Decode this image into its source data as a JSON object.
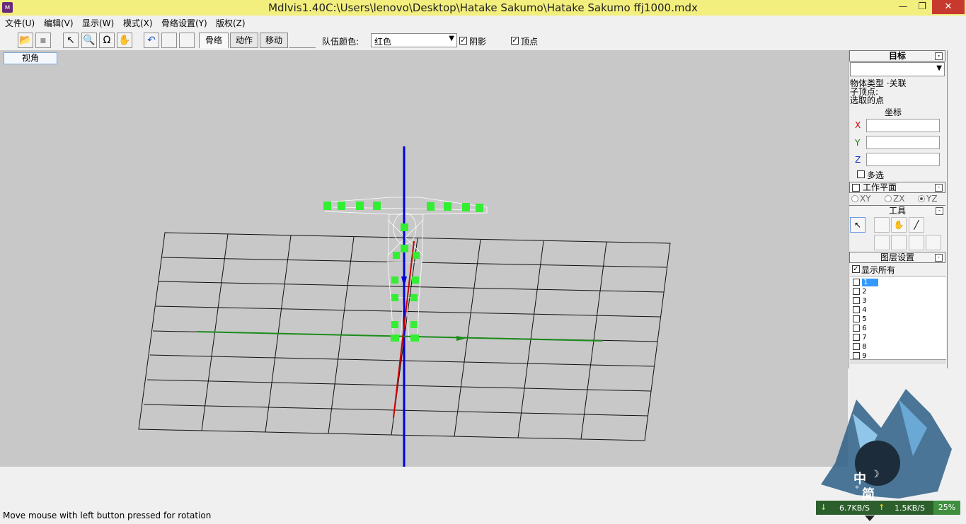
{
  "window": {
    "title": "Mdlvis1.40C:\\Users\\lenovo\\Desktop\\Hatake Sakumo\\Hatake Sakumo ffj1000.mdx",
    "minimize": "—",
    "restore": "❐",
    "close": "✕"
  },
  "menu": [
    "文件(U)",
    "编辑(V)",
    "显示(W)",
    "模式(X)",
    "骨络设置(Y)",
    "版权(Z)"
  ],
  "toolbar": {
    "tabs": [
      "骨络",
      "动作",
      "移动"
    ],
    "team_color_label": "队伍颜色:",
    "team_color_value": "红色",
    "shadow_label": "阴影",
    "vertex_label": "顶点"
  },
  "viewport": {
    "view_button": "视角"
  },
  "panel": {
    "target_header": "目标",
    "object_type": "物体类型 ·关联",
    "child_vertex": "子顶点:",
    "selected_points": "选取的点",
    "coords_header": "坐标",
    "x_label": "X",
    "y_label": "Y",
    "z_label": "Z",
    "multi_select": "多选",
    "work_plane": "工作平面",
    "plane_xy": "XY",
    "plane_zx": "ZX",
    "plane_yz": "YZ",
    "tools_header": "工具",
    "layers_header": "图层设置",
    "show_all": "显示所有",
    "layers": [
      "1",
      "2",
      "3",
      "4",
      "5",
      "6",
      "7",
      "8",
      "9"
    ]
  },
  "status": {
    "text": "Move mouse with left button pressed for rotation"
  },
  "ime": {
    "char1": "中",
    "char2": "简"
  },
  "net": {
    "down": "6.7KB/S",
    "up": "1.5KB/S",
    "percent": "25%"
  },
  "colors": {
    "title_bg": "#f3ef7e",
    "viewport_bg": "#c8c8c8",
    "axis_blue": "#0000dd",
    "axis_red": "#cc0000",
    "axis_green": "#1c8c1c",
    "bone_green": "#33ee33"
  }
}
